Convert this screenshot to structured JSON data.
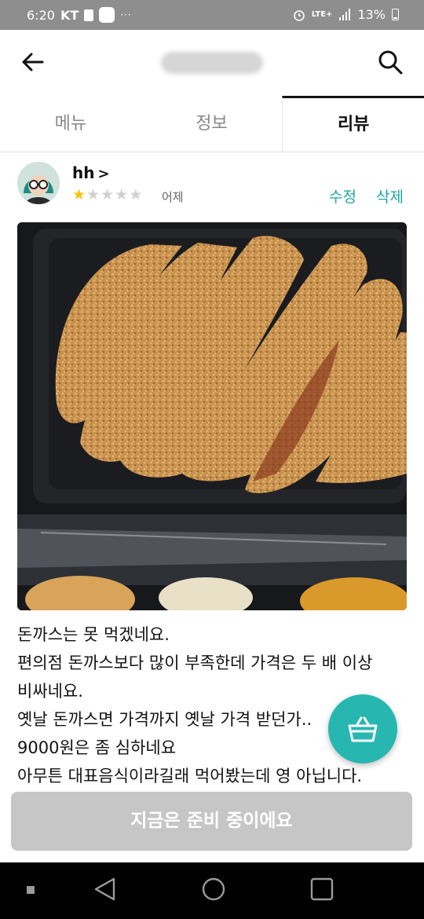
{
  "status_bar": {
    "time": "6:20",
    "carrier": "KT",
    "network": "LTE+",
    "battery": "13%",
    "battery_level": 0.13
  },
  "app_bar": {
    "title": "",
    "back_icon": "arrow-left-icon",
    "search_icon": "search-icon"
  },
  "tabs": [
    {
      "label": "메뉴",
      "active": false
    },
    {
      "label": "정보",
      "active": false
    },
    {
      "label": "리뷰",
      "active": true
    }
  ],
  "review": {
    "username": "hh",
    "chevron": ">",
    "rating": 1,
    "max_rating": 5,
    "date": "어제",
    "edit_label": "수정",
    "delete_label": "삭제",
    "lines": [
      "돈까스는 못 먹겠네요.",
      "편의점 돈까스보다 많이 부족한데 가격은 두 배 이상",
      "비싸네요.",
      "옛날 돈까스면 가격까지 옛날 가격 받던가..",
      "9000원은 좀 심하네요",
      "아무튼 대표음식이라길래 먹어봤는데 영 아닙니다."
    ]
  },
  "cart_icon": "basket-icon",
  "order_button": {
    "label": "지금은 준비 중이에요"
  },
  "colors": {
    "accent": "#1aa8a0",
    "fab": "#27b7b0",
    "disabled_button": "#c6c6c6",
    "star": "#f4c20d"
  },
  "nav": {
    "recent_icon": "recent-apps-icon",
    "back_icon": "nav-back-icon",
    "home_icon": "home-icon",
    "overview_icon": "overview-icon"
  }
}
